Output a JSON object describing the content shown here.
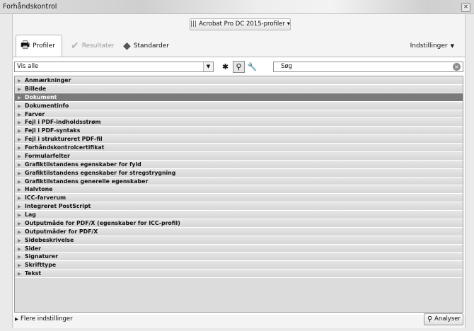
{
  "window": {
    "title": "Forhåndskontrol",
    "close_glyph": "✕"
  },
  "profile_selector": {
    "label": "Acrobat Pro DC 2015-profiler",
    "icon": "library-icon"
  },
  "tabs": [
    {
      "label": "Profiler",
      "icon": "printer-icon",
      "active": true
    },
    {
      "label": "Resultater",
      "icon": "checkmark-icon",
      "active": false
    },
    {
      "label": "Standarder",
      "icon": "standards-icon",
      "active": false
    }
  ],
  "settings": {
    "label": "Indstillinger"
  },
  "filter": {
    "value": "Vis alle"
  },
  "search": {
    "placeholder": "Søg"
  },
  "categories": [
    "Anmærkninger",
    "Billede",
    "Dokument",
    "Dokumentinfo",
    "Farver",
    "Fejl i PDF-indholdsstrøm",
    "Fejl i PDF-syntaks",
    "Fejl i struktureret PDF-fil",
    "Forhåndskontrolcertifikat",
    "Formularfelter",
    "Grafiktilstandens egenskaber for fyld",
    "Grafiktilstandens egenskaber for stregstrygning",
    "Grafiktilstandens generelle egenskaber",
    "Halvtone",
    "ICC-farverum",
    "Integreret PostScript",
    "Lag",
    "Outputmåde for PDF/X (egenskaber for ICC-profil)",
    "Outputmåder for PDF/X",
    "Sidebeskrivelse",
    "Sider",
    "Signaturer",
    "Skrifttype",
    "Tekst"
  ],
  "selected_index": 2,
  "footer": {
    "more_label": "Flere indstillinger",
    "analyze_label": "Analyser"
  },
  "colors": {
    "selected_row": "#7a7a7a",
    "row_bg": "#dcdcdc"
  }
}
